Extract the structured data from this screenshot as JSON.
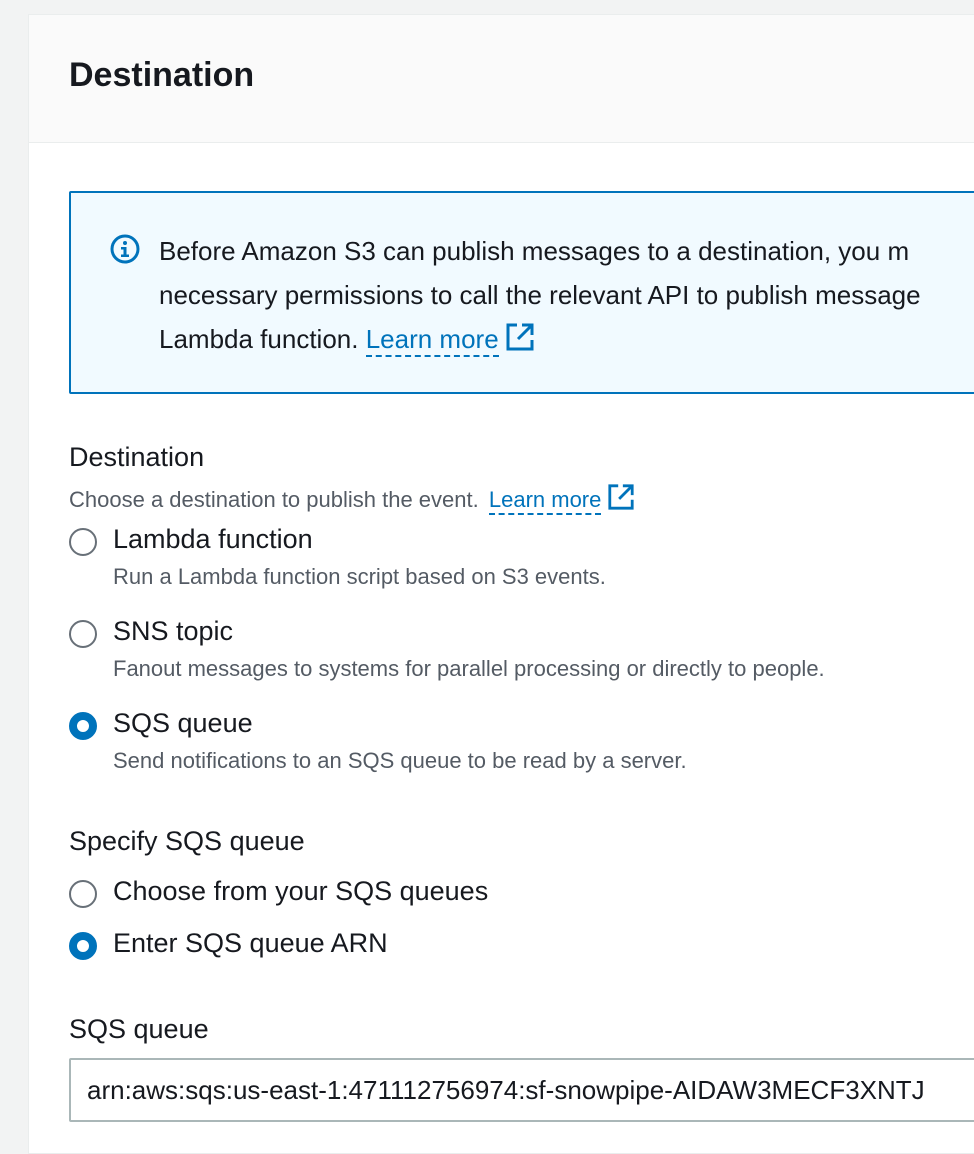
{
  "header": {
    "title": "Destination"
  },
  "info": {
    "line1": "Before Amazon S3 can publish messages to a destination, you m",
    "line2": "necessary permissions to call the relevant API to publish message",
    "line3_prefix": "Lambda function. ",
    "learn_more": "Learn more"
  },
  "destination": {
    "label": "Destination",
    "description": "Choose a destination to publish the event.",
    "learn_more": "Learn more",
    "options": [
      {
        "label": "Lambda function",
        "description": "Run a Lambda function script based on S3 events.",
        "checked": false
      },
      {
        "label": "SNS topic",
        "description": "Fanout messages to systems for parallel processing or directly to people.",
        "checked": false
      },
      {
        "label": "SQS queue",
        "description": "Send notifications to an SQS queue to be read by a server.",
        "checked": true
      }
    ]
  },
  "specify": {
    "label": "Specify SQS queue",
    "options": [
      {
        "label": "Choose from your SQS queues",
        "checked": false
      },
      {
        "label": "Enter SQS queue ARN",
        "checked": true
      }
    ]
  },
  "sqs_queue": {
    "label": "SQS queue",
    "value": "arn:aws:sqs:us-east-1:471112756974:sf-snowpipe-AIDAW3MECF3XNTJ"
  },
  "icons": {
    "info": "info-circle-icon",
    "external": "external-link-icon"
  },
  "colors": {
    "accent": "#0073bb",
    "info_bg": "#f1faff",
    "text": "#16191f",
    "secondary_text": "#545b64"
  }
}
